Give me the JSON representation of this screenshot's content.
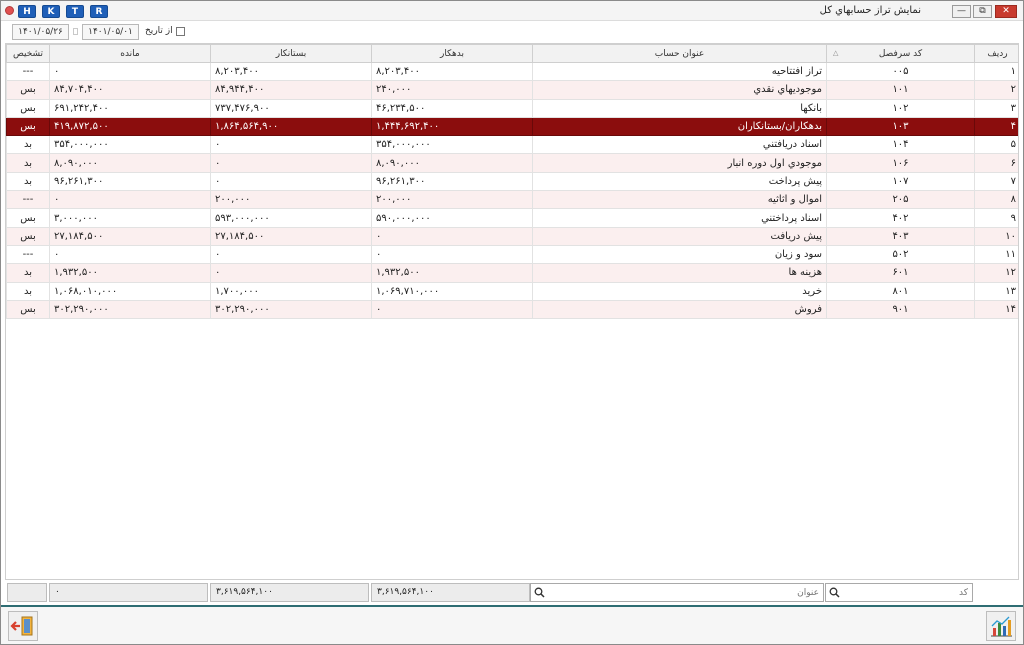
{
  "window": {
    "title": "نمايش تراز حسابهاي كل",
    "hotkeys": [
      "H",
      "K",
      "T",
      "R"
    ],
    "controls": {
      "minimize": "—",
      "restore": "⧉",
      "close": "✕"
    }
  },
  "filters": {
    "to_date": "۱۴۰۱/۰۵/۲۶",
    "from_date": "۱۴۰۱/۰۵/۰۱",
    "from_date_label": "از تاريخ"
  },
  "columns": {
    "idx": "رديف",
    "code": "كد سرفصل",
    "title": "عنوان حساب",
    "debit": "بدهكار",
    "credit": "بستانكار",
    "balance": "مانده",
    "diagnosis": "تشخيص"
  },
  "rows": [
    {
      "idx": "۱",
      "code": "۰۰۵",
      "title": "تراز افتتاحيه",
      "debit": "۸,۲۰۳,۴۰۰",
      "credit": "۸,۲۰۳,۴۰۰",
      "balance": "۰",
      "diagnosis": "---"
    },
    {
      "idx": "۲",
      "code": "۱۰۱",
      "title": "موجوديهاي نقدي",
      "debit": "۲۴۰,۰۰۰",
      "credit": "۸۴,۹۴۴,۴۰۰",
      "balance": "۸۴,۷۰۴,۴۰۰",
      "diagnosis": "بس"
    },
    {
      "idx": "۳",
      "code": "۱۰۲",
      "title": "بانكها",
      "debit": "۴۶,۲۳۴,۵۰۰",
      "credit": "۷۳۷,۴۷۶,۹۰۰",
      "balance": "۶۹۱,۲۴۲,۴۰۰",
      "diagnosis": "بس"
    },
    {
      "idx": "۴",
      "code": "۱۰۳",
      "title": "بدهكاران/بستانكاران",
      "debit": "۱,۴۴۴,۶۹۲,۴۰۰",
      "credit": "۱,۸۶۴,۵۶۴,۹۰۰",
      "balance": "۴۱۹,۸۷۲,۵۰۰",
      "diagnosis": "بس"
    },
    {
      "idx": "۵",
      "code": "۱۰۴",
      "title": "اسناد دريافتني",
      "debit": "۳۵۴,۰۰۰,۰۰۰",
      "credit": "۰",
      "balance": "۳۵۴,۰۰۰,۰۰۰",
      "diagnosis": "بد"
    },
    {
      "idx": "۶",
      "code": "۱۰۶",
      "title": "موجودي اول دوره انبار",
      "debit": "۸,۰۹۰,۰۰۰",
      "credit": "۰",
      "balance": "۸,۰۹۰,۰۰۰",
      "diagnosis": "بد"
    },
    {
      "idx": "۷",
      "code": "۱۰۷",
      "title": "پيش پرداخت",
      "debit": "۹۶,۲۶۱,۳۰۰",
      "credit": "۰",
      "balance": "۹۶,۲۶۱,۳۰۰",
      "diagnosis": "بد"
    },
    {
      "idx": "۸",
      "code": "۲۰۵",
      "title": "اموال و اثاثيه",
      "debit": "۲۰۰,۰۰۰",
      "credit": "۲۰۰,۰۰۰",
      "balance": "۰",
      "diagnosis": "---"
    },
    {
      "idx": "۹",
      "code": "۴۰۲",
      "title": "اسناد پرداختني",
      "debit": "۵۹۰,۰۰۰,۰۰۰",
      "credit": "۵۹۳,۰۰۰,۰۰۰",
      "balance": "۳,۰۰۰,۰۰۰",
      "diagnosis": "بس"
    },
    {
      "idx": "۱۰",
      "code": "۴۰۳",
      "title": "پيش دريافت",
      "debit": "۰",
      "credit": "۲۷,۱۸۴,۵۰۰",
      "balance": "۲۷,۱۸۴,۵۰۰",
      "diagnosis": "بس"
    },
    {
      "idx": "۱۱",
      "code": "۵۰۲",
      "title": "سود و زيان",
      "debit": "۰",
      "credit": "۰",
      "balance": "۰",
      "diagnosis": "---"
    },
    {
      "idx": "۱۲",
      "code": "۶۰۱",
      "title": "هزينه ها",
      "debit": "۱,۹۳۲,۵۰۰",
      "credit": "۰",
      "balance": "۱,۹۳۲,۵۰۰",
      "diagnosis": "بد"
    },
    {
      "idx": "۱۳",
      "code": "۸۰۱",
      "title": "خريد",
      "debit": "۱,۰۶۹,۷۱۰,۰۰۰",
      "credit": "۱,۷۰۰,۰۰۰",
      "balance": "۱,۰۶۸,۰۱۰,۰۰۰",
      "diagnosis": "بد"
    },
    {
      "idx": "۱۴",
      "code": "۹۰۱",
      "title": "فروش",
      "debit": "۰",
      "credit": "۳۰۲,۲۹۰,۰۰۰",
      "balance": "۳۰۲,۲۹۰,۰۰۰",
      "diagnosis": "بس"
    }
  ],
  "selected_row": 3,
  "footer": {
    "code_placeholder": "كد",
    "title_placeholder": "عنوان",
    "debit_total": "۳,۶۱۹,۵۶۴,۱۰۰",
    "credit_total": "۳,۶۱۹,۵۶۴,۱۰۰",
    "balance_total": "۰"
  },
  "colors": {
    "selected_row": "#8b0d0d",
    "alt_row": "#fbefef",
    "hotkey": "#1f5fb8",
    "bottom_accent": "#2e6d73"
  },
  "icons": {
    "exit": "exit-door-icon",
    "chart": "bar-chart-icon",
    "search": "search-icon"
  }
}
